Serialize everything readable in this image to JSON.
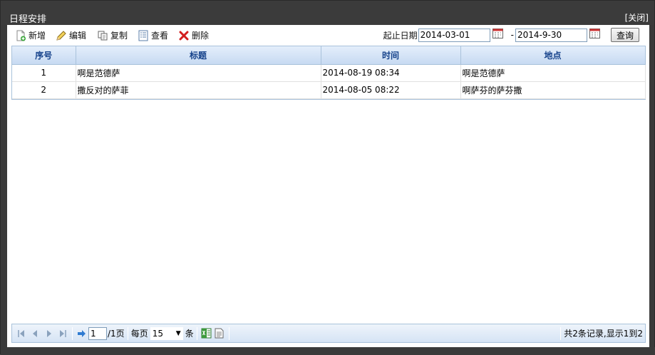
{
  "window": {
    "title": "日程安排",
    "close_label": "[关闭]"
  },
  "toolbar": {
    "buttons": [
      {
        "label": "新增",
        "icon": "add-doc-icon"
      },
      {
        "label": "编辑",
        "icon": "pencil-icon"
      },
      {
        "label": "复制",
        "icon": "copy-icon"
      },
      {
        "label": "查看",
        "icon": "view-list-icon"
      },
      {
        "label": "删除",
        "icon": "delete-x-icon"
      }
    ],
    "date_label": "起止日期",
    "start_date": "2014-03-01",
    "end_date": "2014-9-30",
    "dash": "-",
    "query_label": "查询"
  },
  "table": {
    "columns": [
      "序号",
      "标题",
      "时间",
      "地点"
    ],
    "rows": [
      [
        "1",
        "啊是范德萨",
        "2014-08-19 08:34",
        "啊是范德萨"
      ],
      [
        "2",
        "撒反对的萨菲",
        "2014-08-05 08:22",
        "啊萨芬的萨芬撒"
      ]
    ]
  },
  "pager": {
    "page_value": "1",
    "total_pages": "/1页",
    "per_page_label": "每页",
    "per_page_value": "15",
    "per_page_unit": "条",
    "info": "共2条记录,显示1到2"
  },
  "colors": {
    "header_text": "#15428b",
    "titlebar": "#3b3b3b",
    "grid_border": "#a9c2db"
  }
}
